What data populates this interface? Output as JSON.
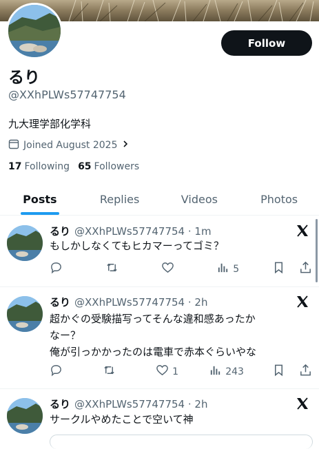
{
  "profile": {
    "name": "るり",
    "handle": "@XXhPLWs57747754",
    "bio": "九大理学部化学科",
    "joined": "Joined August 2025",
    "following_count": "17",
    "following_label": "Following",
    "followers_count": "65",
    "followers_label": "Followers",
    "follow_label": "Follow"
  },
  "tabs": [
    {
      "label": "Posts",
      "active": true
    },
    {
      "label": "Replies",
      "active": false
    },
    {
      "label": "Videos",
      "active": false
    },
    {
      "label": "Photos",
      "active": false
    }
  ],
  "tweets": [
    {
      "name": "るり",
      "meta": "@XXhPLWs57747754 · 1m",
      "lines": [
        "もしかしなくてもヒカマーってゴミ？"
      ],
      "likes": "",
      "views": "5"
    },
    {
      "name": "るり",
      "meta": "@XXhPLWs57747754 · 2h",
      "lines": [
        "超かぐの受験描写ってそんな違和感あったか",
        "なー？",
        "俺が引っかかったのは電車で赤本ぐらいやな"
      ],
      "likes": "1",
      "views": "243"
    },
    {
      "name": "るり",
      "meta": "@XXhPLWs57747754 · 2h",
      "lines": [
        "サークルやめたことで空いて神"
      ],
      "likes": "",
      "views": ""
    }
  ],
  "icons": {
    "reply": "reply-icon",
    "retweet": "retweet-icon",
    "like": "like-icon",
    "views": "views-icon",
    "bookmark": "bookmark-icon",
    "share": "share-icon",
    "x_logo": "x-logo-icon",
    "calendar": "calendar-icon",
    "chevron": "chevron-right-icon"
  },
  "colors": {
    "accent": "#1d9bf0",
    "text": "#0f1419",
    "muted": "#536471",
    "button": "#0f1419"
  }
}
